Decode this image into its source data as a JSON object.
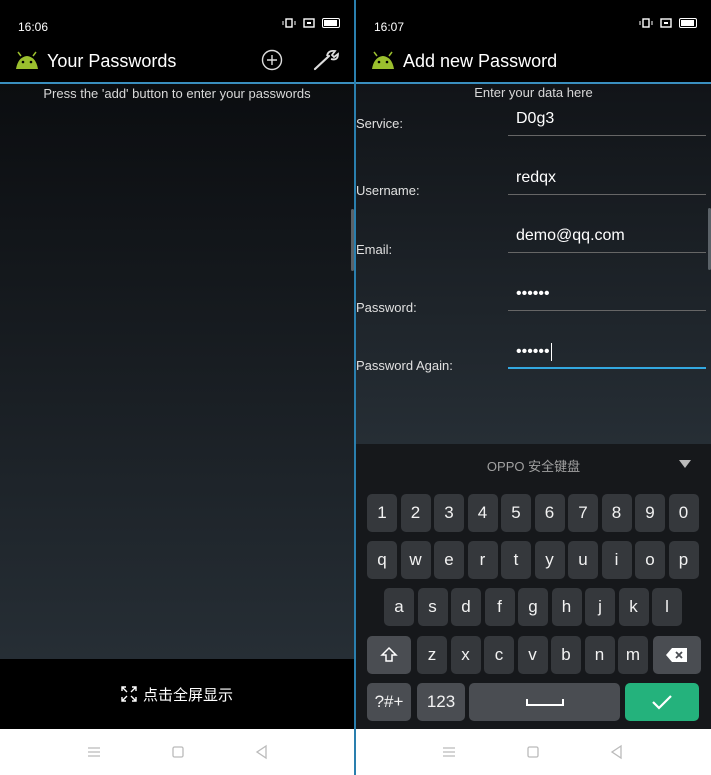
{
  "left_screen": {
    "status_time": "16:06",
    "title": "Your Passwords",
    "hint": "Press the 'add' button to enter your passwords",
    "fullscreen_label": "点击全屏显示"
  },
  "right_screen": {
    "status_time": "16:07",
    "title": "Add new Password",
    "hint": "Enter your data here",
    "fields": [
      {
        "label": "Service:",
        "value": "D0g3"
      },
      {
        "label": "Username:",
        "value": "redqx"
      },
      {
        "label": "Email:",
        "value": "demo@qq.com"
      },
      {
        "label": "Password:",
        "value": "••••••"
      },
      {
        "label": "Password Again:",
        "value": "••••••"
      }
    ],
    "keyboard": {
      "name": "OPPO 安全键盘",
      "digits": [
        "1",
        "2",
        "3",
        "4",
        "5",
        "6",
        "7",
        "8",
        "9",
        "0"
      ],
      "row1": [
        "q",
        "w",
        "e",
        "r",
        "t",
        "y",
        "u",
        "i",
        "o",
        "p"
      ],
      "row2": [
        "a",
        "s",
        "d",
        "f",
        "g",
        "h",
        "j",
        "k",
        "l"
      ],
      "row3": [
        "z",
        "x",
        "c",
        "v",
        "b",
        "n",
        "m"
      ],
      "symbols_label": "?#+",
      "numbers_label": "123"
    }
  },
  "colors": {
    "accent": "#33a8e0",
    "confirm": "#24b27c",
    "logo": "#9bbf2e"
  }
}
